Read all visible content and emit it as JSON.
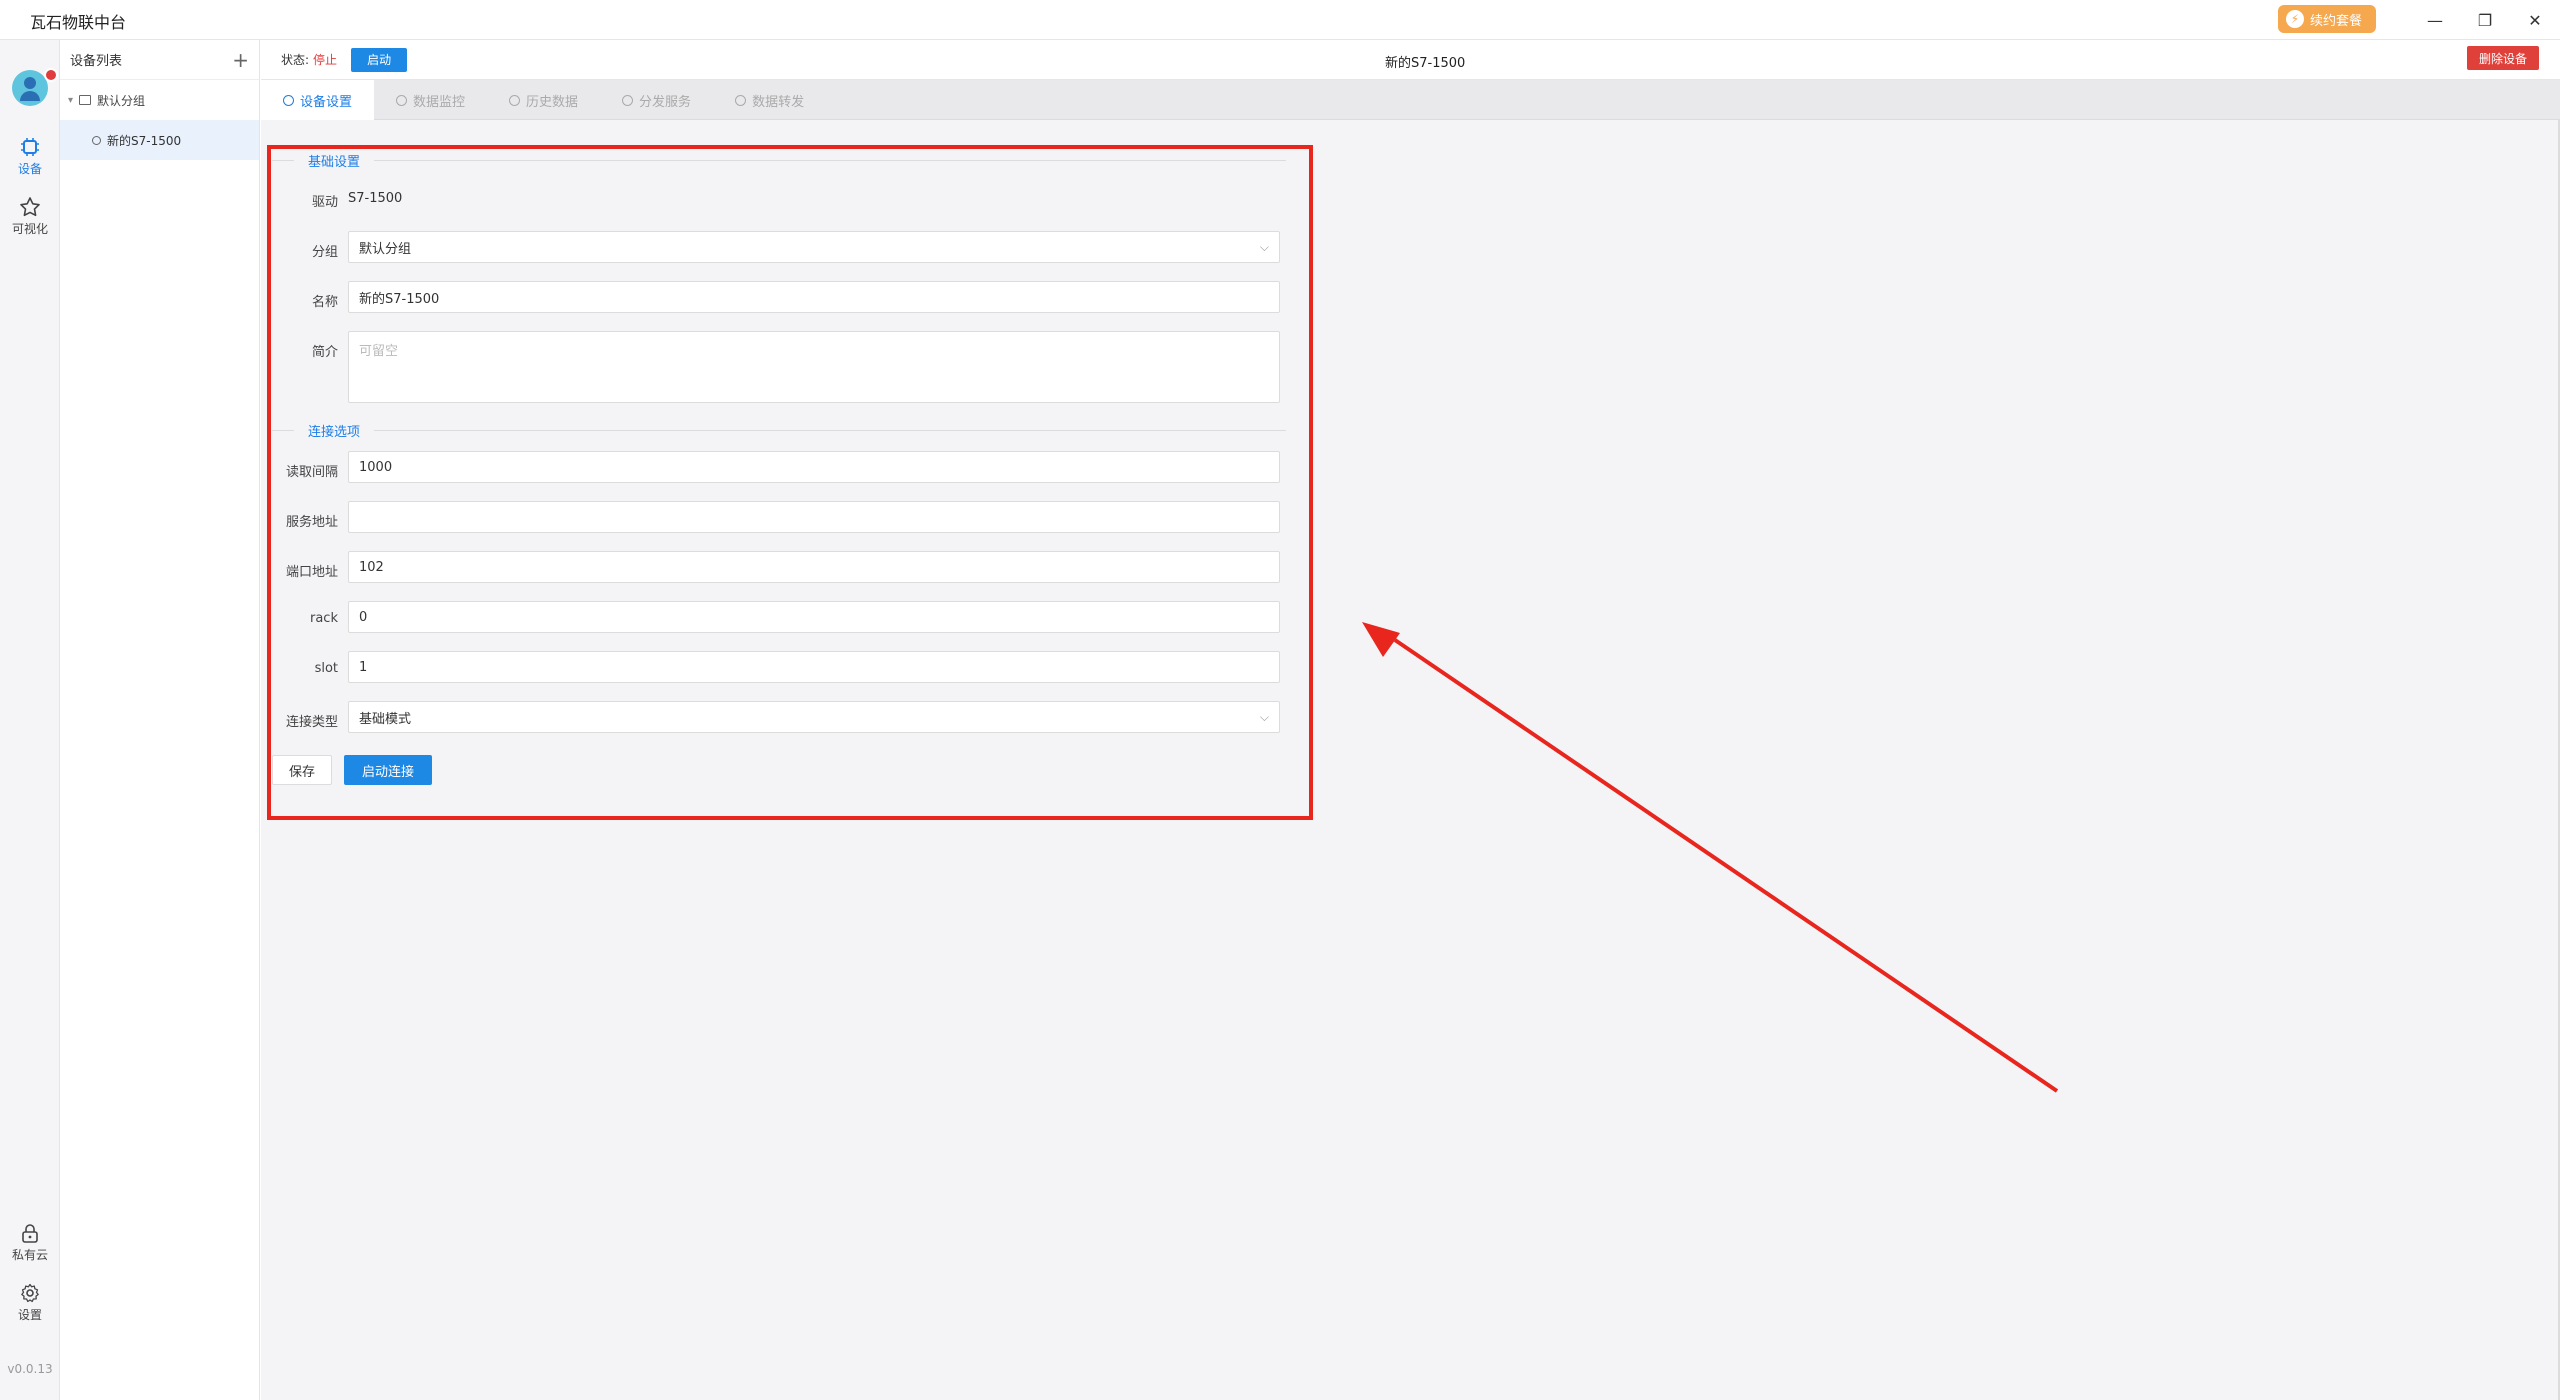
{
  "window": {
    "title": "瓦石物联中台",
    "renew_label": "续约套餐",
    "minimize": "—",
    "restore": "❐",
    "close": "✕"
  },
  "rail": {
    "items": [
      {
        "label": "设备",
        "icon": "chip-icon",
        "active": true
      },
      {
        "label": "可视化",
        "icon": "star-icon",
        "active": false
      },
      {
        "label": "私有云",
        "icon": "lock-icon",
        "active": false
      },
      {
        "label": "设置",
        "icon": "gear-icon",
        "active": false
      }
    ],
    "version": "v0.0.13"
  },
  "device_list": {
    "title": "设备列表",
    "add": "+",
    "group": "默认分组",
    "device": "新的S7-1500"
  },
  "status": {
    "label": "状态:",
    "value": "停止",
    "start_button": "启动",
    "device_title": "新的S7-1500",
    "delete_button": "删除设备"
  },
  "tabs": [
    {
      "label": "设备设置",
      "active": true
    },
    {
      "label": "数据监控",
      "active": false
    },
    {
      "label": "历史数据",
      "active": false
    },
    {
      "label": "分发服务",
      "active": false
    },
    {
      "label": "数据转发",
      "active": false
    }
  ],
  "form": {
    "basic_section": "基础设置",
    "driver_label": "驱动",
    "driver_value": "S7-1500",
    "group_label": "分组",
    "group_value": "默认分组",
    "name_label": "名称",
    "name_value": "新的S7-1500",
    "desc_label": "简介",
    "desc_placeholder": "可留空",
    "connection_section": "连接选项",
    "interval_label": "读取间隔",
    "interval_value": "1000",
    "server_label": "服务地址",
    "server_value": "",
    "port_label": "端口地址",
    "port_value": "102",
    "rack_label": "rack",
    "rack_value": "0",
    "slot_label": "slot",
    "slot_value": "1",
    "conn_type_label": "连接类型",
    "conn_type_value": "基础模式",
    "save_button": "保存",
    "connect_button": "启动连接"
  },
  "colors": {
    "accent": "#1e88e5",
    "danger": "#e0403a",
    "annotation": "#e8261e",
    "renew": "#f6a84f"
  }
}
